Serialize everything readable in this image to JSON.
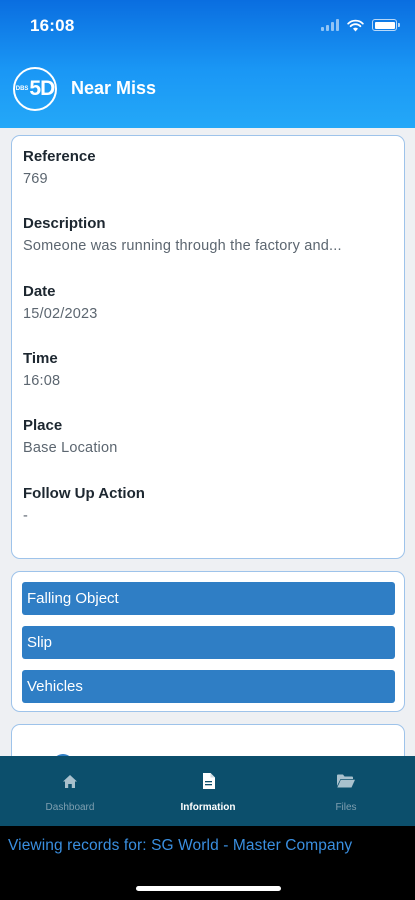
{
  "status_bar": {
    "time": "16:08",
    "icons": [
      "signal-icon",
      "wifi-icon",
      "battery-icon"
    ]
  },
  "app_bar": {
    "logo": {
      "small_text": "DBS",
      "big_text": "5D"
    },
    "title": "Near Miss"
  },
  "details": [
    {
      "label": "Reference",
      "value": "769"
    },
    {
      "label": "Description",
      "value": "Someone was running through the factory and..."
    },
    {
      "label": "Date",
      "value": "15/02/2023"
    },
    {
      "label": "Time",
      "value": "16:08"
    },
    {
      "label": "Place",
      "value": "Base Location"
    },
    {
      "label": "Follow Up Action",
      "value": "-"
    }
  ],
  "tags": [
    "Falling Object",
    "Slip",
    "Vehicles"
  ],
  "tab_bar": {
    "tabs": [
      {
        "label": "Dashboard",
        "icon": "home-icon",
        "active": false
      },
      {
        "label": "Information",
        "icon": "document-icon",
        "active": true
      },
      {
        "label": "Files",
        "icon": "folder-icon",
        "active": false
      }
    ]
  },
  "footer": {
    "text": "Viewing records for: SG World - Master Company"
  },
  "colors": {
    "header_top": "#0a6ee0",
    "header_bottom": "#24a8f8",
    "tag_bg": "#2f7ec5",
    "tab_bar_bg": "#0c4f6c",
    "footer_text": "#3a8fe0"
  }
}
